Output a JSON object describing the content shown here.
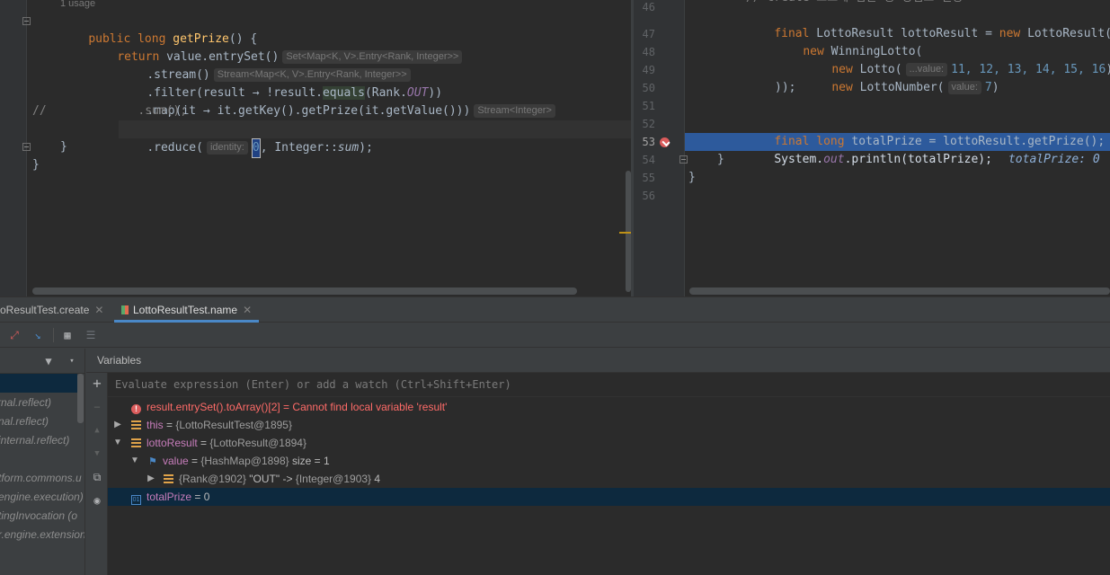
{
  "left_editor": {
    "usage_hint": "1 usage",
    "lines": {
      "l1_kw1": "public",
      "l1_kw2": "long",
      "l1_fn": "getPrize",
      "l1_rest": "() {",
      "l2_kw": "return",
      "l2_code": "value.entrySet()",
      "l2_hint": "Set<Map<K, V>.Entry<Rank, Integer>>",
      "l3_code": ".stream()",
      "l3_hint": "Stream<Map<K, V>.Entry<Rank, Integer>>",
      "l4_a": ".filter(result → !result.",
      "l4_eq": "equals",
      "l4_b": "(Rank.",
      "l4_fld": "OUT",
      "l4_c": "))",
      "l5_code": ".map(it → it.getKey().getPrize(it.getValue()))",
      "l5_hint": "Stream<Integer>",
      "l6_comment": "//             .sum();",
      "l7_a": ".reduce(",
      "l7_hint": "identity:",
      "l7_zero": "0",
      "l7_b": ", Integer::",
      "l7_it": "sum",
      "l7_c": ");",
      "l8": "}",
      "l9": "}"
    }
  },
  "right_editor": {
    "line_numbers": [
      "46",
      "47",
      "48",
      "49",
      "50",
      "51",
      "52",
      "53",
      "54",
      "55",
      "56"
    ],
    "top_comment": "// create 로또에 담은 등 당첨로 설정",
    "l46_kw": "final",
    "l46_code": "LottoResult lottoResult = ",
    "l46_kw2": "new",
    "l46_code2": "LottoResult(lot",
    "l47_kw": "new",
    "l47_code": "WinningLotto(",
    "l48_kw": "new",
    "l48_code": "Lotto(",
    "l48_hint": "...value:",
    "l48_nums": "11, 12, 13, 14, 15, 16",
    "l48_end": "),",
    "l49_kw": "new",
    "l49_code": "LottoNumber(",
    "l49_hint": "value:",
    "l49_num": "7",
    "l49_end": ")",
    "l50": "));",
    "l52_kw1": "final",
    "l52_kw2": "long",
    "l52_code": "totalPrize = lottoResult.getPrize();",
    "l52_trail": "t",
    "l53_a": "System.",
    "l53_fld": "out",
    "l53_b": ".println(totalPrize);",
    "l53_inline": "totalPrize: 0",
    "l54": "}",
    "l55": "}"
  },
  "debug": {
    "tabs": [
      {
        "label": "oResultTest.create"
      },
      {
        "label": "LottoResultTest.name"
      }
    ],
    "variables_title": "Variables",
    "eval_placeholder": "Evaluate expression (Enter) or add a watch (Ctrl+Shift+Enter)",
    "frames": [
      "rnal.reflect)",
      "nal.reflect)",
      "internal.reflect)",
      "tform.commons.u",
      "engine.execution)",
      "tingInvocation (o",
      "r.engine.extension"
    ],
    "vars": {
      "err_expr": "result.entrySet().toArray()[2]",
      "err_msg": "Cannot find local variable 'result'",
      "this_name": "this",
      "this_val": "{LottoResultTest@1895}",
      "lr_name": "lottoResult",
      "lr_val": "{LottoResult@1894}",
      "value_name": "value",
      "value_val": "{HashMap@1898}",
      "value_size": "size = 1",
      "entry_key": "{Rank@1902}",
      "entry_str": "\"OUT\"",
      "entry_arrow": "->",
      "entry_val": "{Integer@1903}",
      "entry_num": "4",
      "tp_name": "totalPrize",
      "tp_val": "0"
    }
  },
  "colors": {
    "keyword": "#cc7832",
    "function": "#ffc66d",
    "number": "#6897bb",
    "field": "#9876aa",
    "exec_line": "#2d5a9c",
    "selection": "#0d293e"
  }
}
